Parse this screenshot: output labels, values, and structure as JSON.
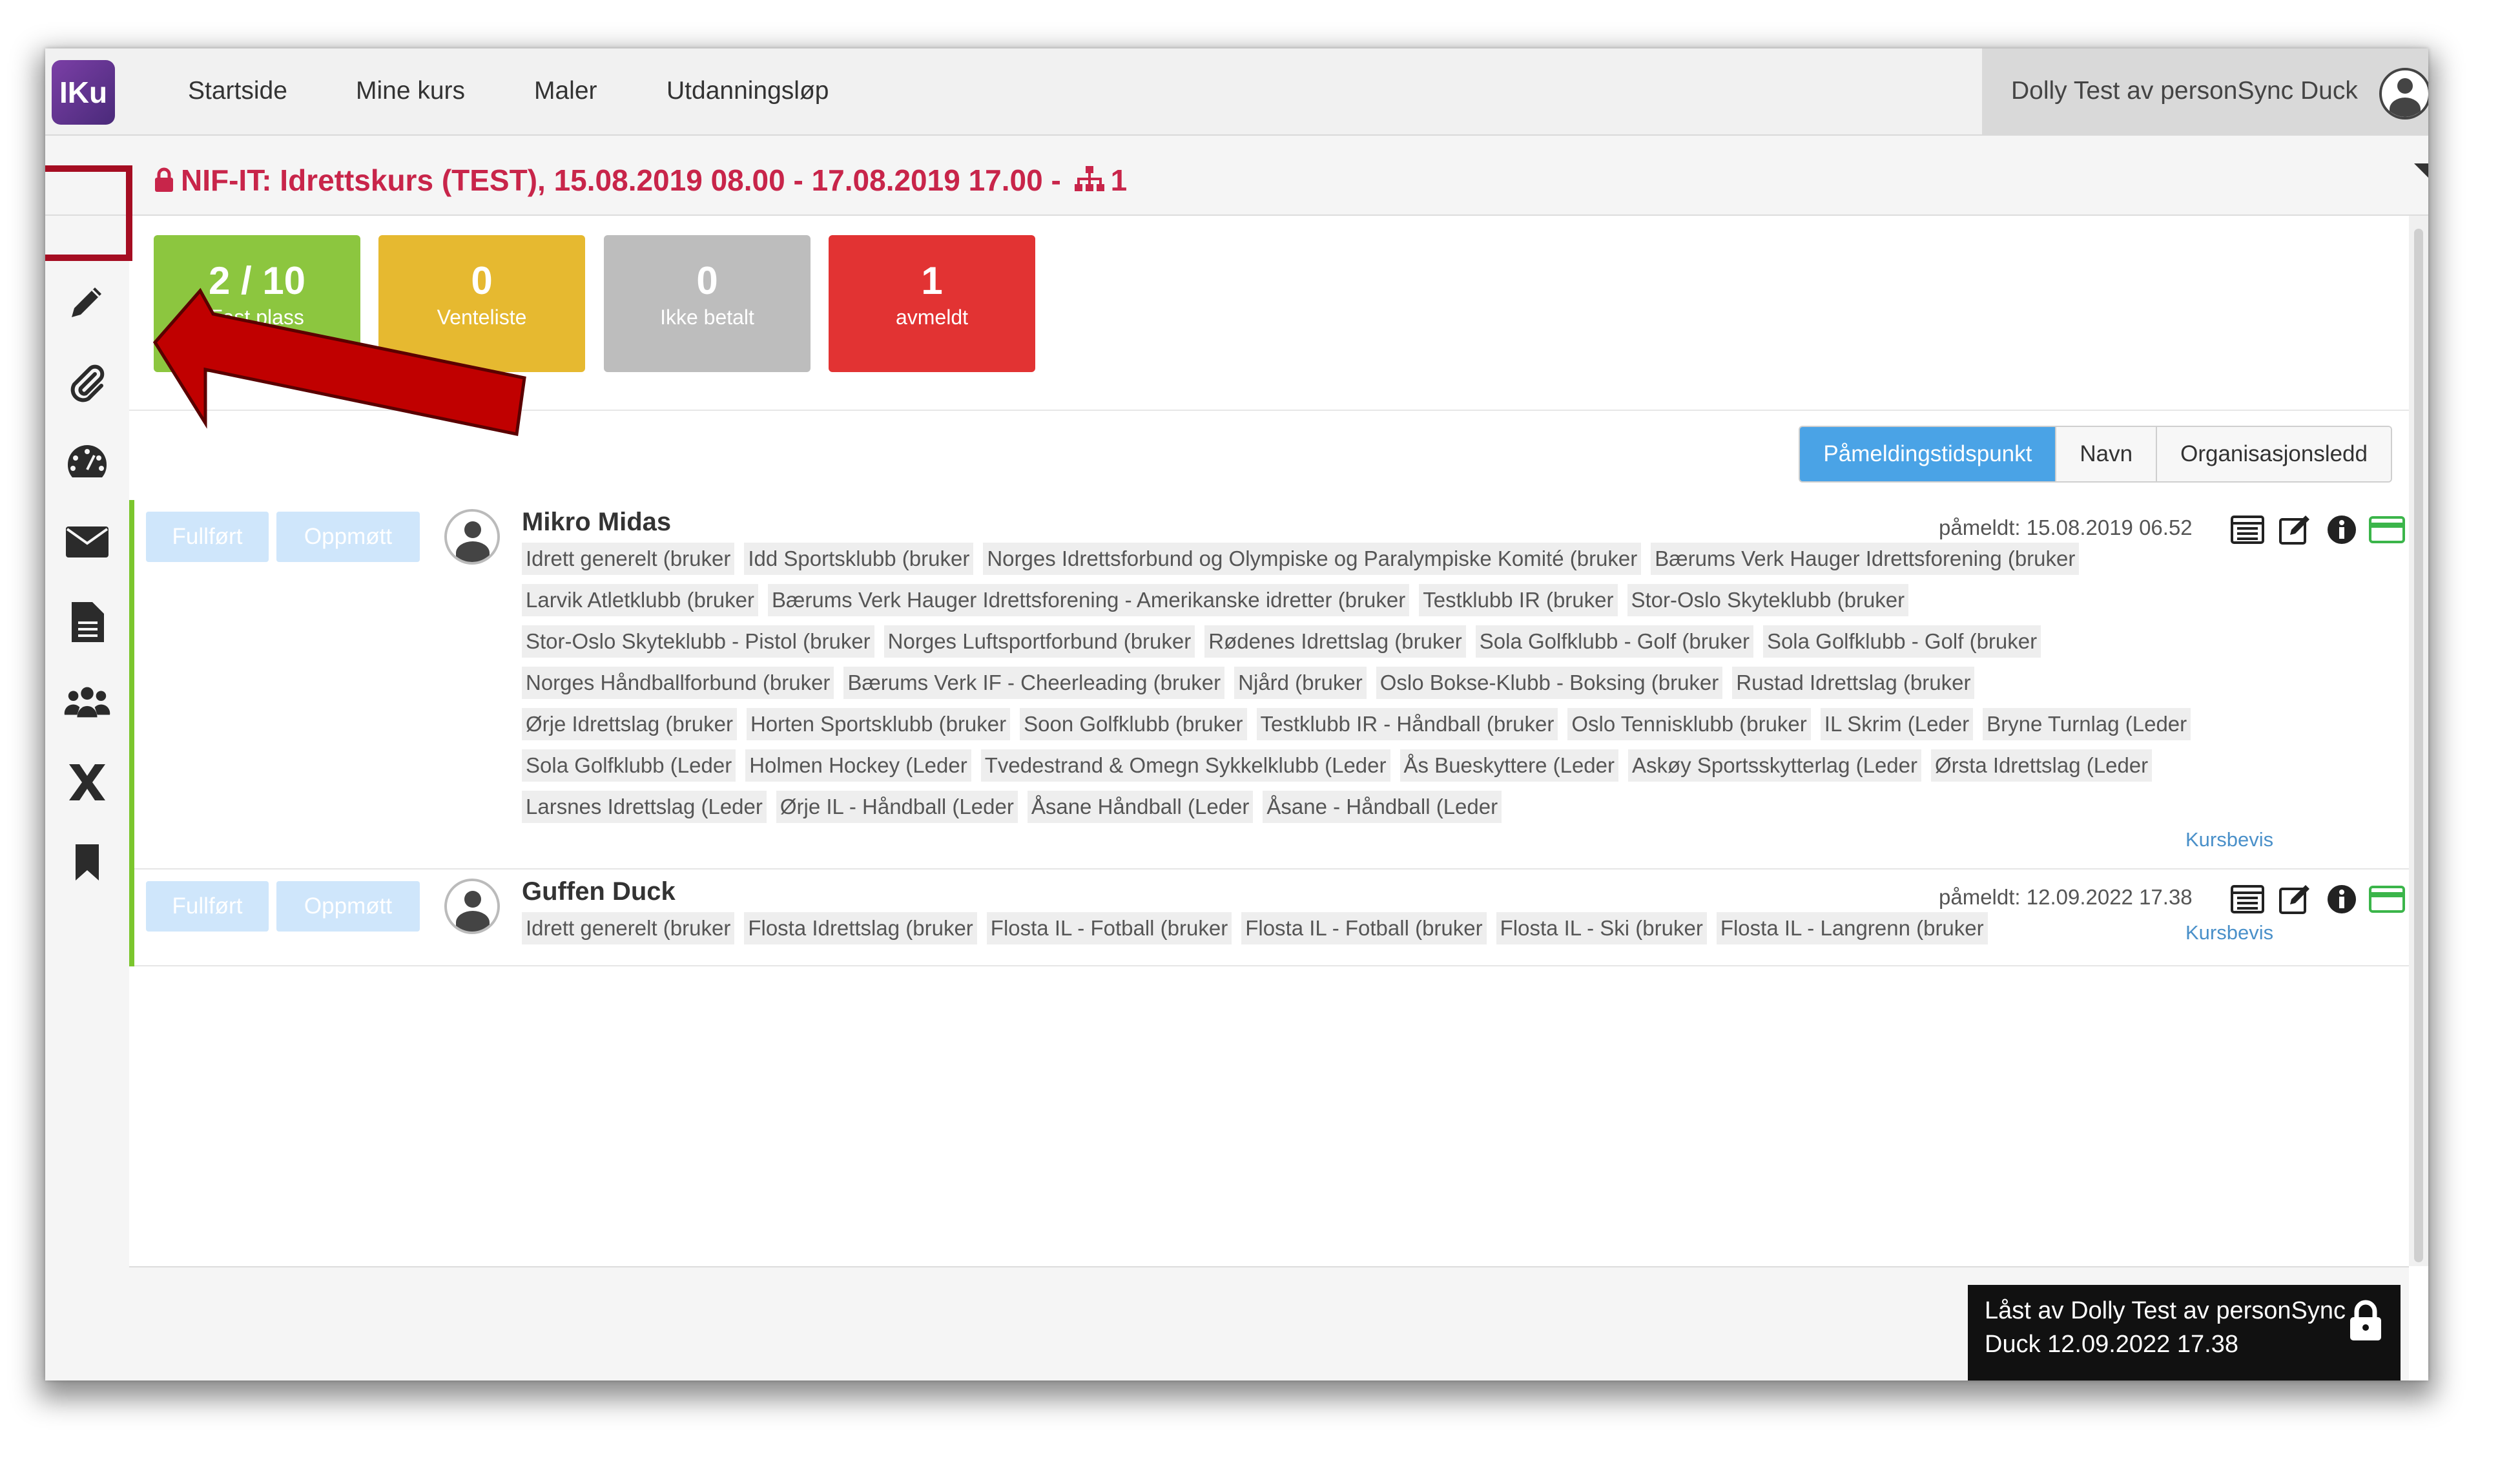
{
  "nav": {
    "logo": "IKu",
    "links": [
      "Startside",
      "Mine kurs",
      "Maler",
      "Utdanningsløp"
    ],
    "user": "Dolly Test av personSync Duck"
  },
  "title": {
    "text": "NIF-IT: Idrettskurs (TEST), 15.08.2019 08.00 - 17.08.2019 17.00 -",
    "org_count": "1"
  },
  "sidebar": {
    "icons": [
      "pencil-icon",
      "paperclip-icon",
      "dashboard-icon",
      "envelope-icon",
      "document-icon",
      "group-icon",
      "excel-icon",
      "bookmark-icon"
    ]
  },
  "stats": [
    {
      "num": "2 / 10",
      "label": "Fast plass",
      "color": "#8cc63f"
    },
    {
      "num": "0",
      "label": "Venteliste",
      "color": "#e6b930"
    },
    {
      "num": "0",
      "label": "Ikke betalt",
      "color": "#bdbdbd"
    },
    {
      "num": "1",
      "label": "avmeldt",
      "color": "#e23333"
    }
  ],
  "sort": [
    "Påmeldingstidspunkt",
    "Navn",
    "Organisasjonsledd"
  ],
  "buttons": {
    "fullfort": "Fullført",
    "oppmott": "Oppmøtt"
  },
  "participants": [
    {
      "name": "Mikro Midas",
      "paameldt": "påmeldt: 15.08.2019 06.52",
      "kursbevis": "Kursbevis",
      "tags": [
        "Idrett generelt (bruker",
        "Idd Sportsklubb (bruker",
        "Norges Idrettsforbund og Olympiske og Paralympiske Komité (bruker",
        "Bærums Verk Hauger Idrettsforening (bruker",
        "Larvik Atletklubb (bruker",
        "Bærums Verk Hauger Idrettsforening - Amerikanske idretter (bruker",
        "Testklubb IR (bruker",
        "Stor-Oslo Skyteklubb (bruker",
        "Stor-Oslo Skyteklubb - Pistol (bruker",
        "Norges Luftsportforbund (bruker",
        "Rødenes Idrettslag (bruker",
        "Sola Golfklubb - Golf (bruker",
        "Sola Golfklubb - Golf (bruker",
        "Norges Håndballforbund (bruker",
        "Bærums Verk IF - Cheerleading (bruker",
        "Njård (bruker",
        "Oslo Bokse-Klubb - Boksing (bruker",
        "Rustad Idrettslag (bruker",
        "Ørje Idrettslag (bruker",
        "Horten Sportsklubb (bruker",
        "Soon Golfklubb (bruker",
        "Testklubb IR - Håndball (bruker",
        "Oslo Tennisklubb (bruker",
        "IL Skrim (Leder",
        "Bryne Turnlag (Leder",
        "Sola Golfklubb (Leder",
        "Holmen Hockey (Leder",
        "Tvedestrand & Omegn Sykkelklubb (Leder",
        "Ås Bueskyttere (Leder",
        "Askøy Sportsskytterlag (Leder",
        "Ørsta Idrettslag (Leder",
        "Larsnes Idrettslag (Leder",
        "Ørje IL - Håndball (Leder",
        "Åsane Håndball (Leder",
        "Åsane - Håndball (Leder"
      ]
    },
    {
      "name": "Guffen Duck",
      "paameldt": "påmeldt: 12.09.2022 17.38",
      "kursbevis": "Kursbevis",
      "tags": [
        "Idrett generelt (bruker",
        "Flosta Idrettslag (bruker",
        "Flosta IL - Fotball (bruker",
        "Flosta IL - Fotball (bruker",
        "Flosta IL - Ski (bruker",
        "Flosta IL - Langrenn (bruker"
      ]
    }
  ],
  "lock_notice": "Låst av Dolly Test av personSync Duck 12.09.2022 17.38",
  "colors": {
    "title": "#c8254a",
    "active_sort": "#4aa3e6",
    "row_border": "#7bc62d",
    "highlight": "#a50d22",
    "arrow": "#c00000"
  }
}
